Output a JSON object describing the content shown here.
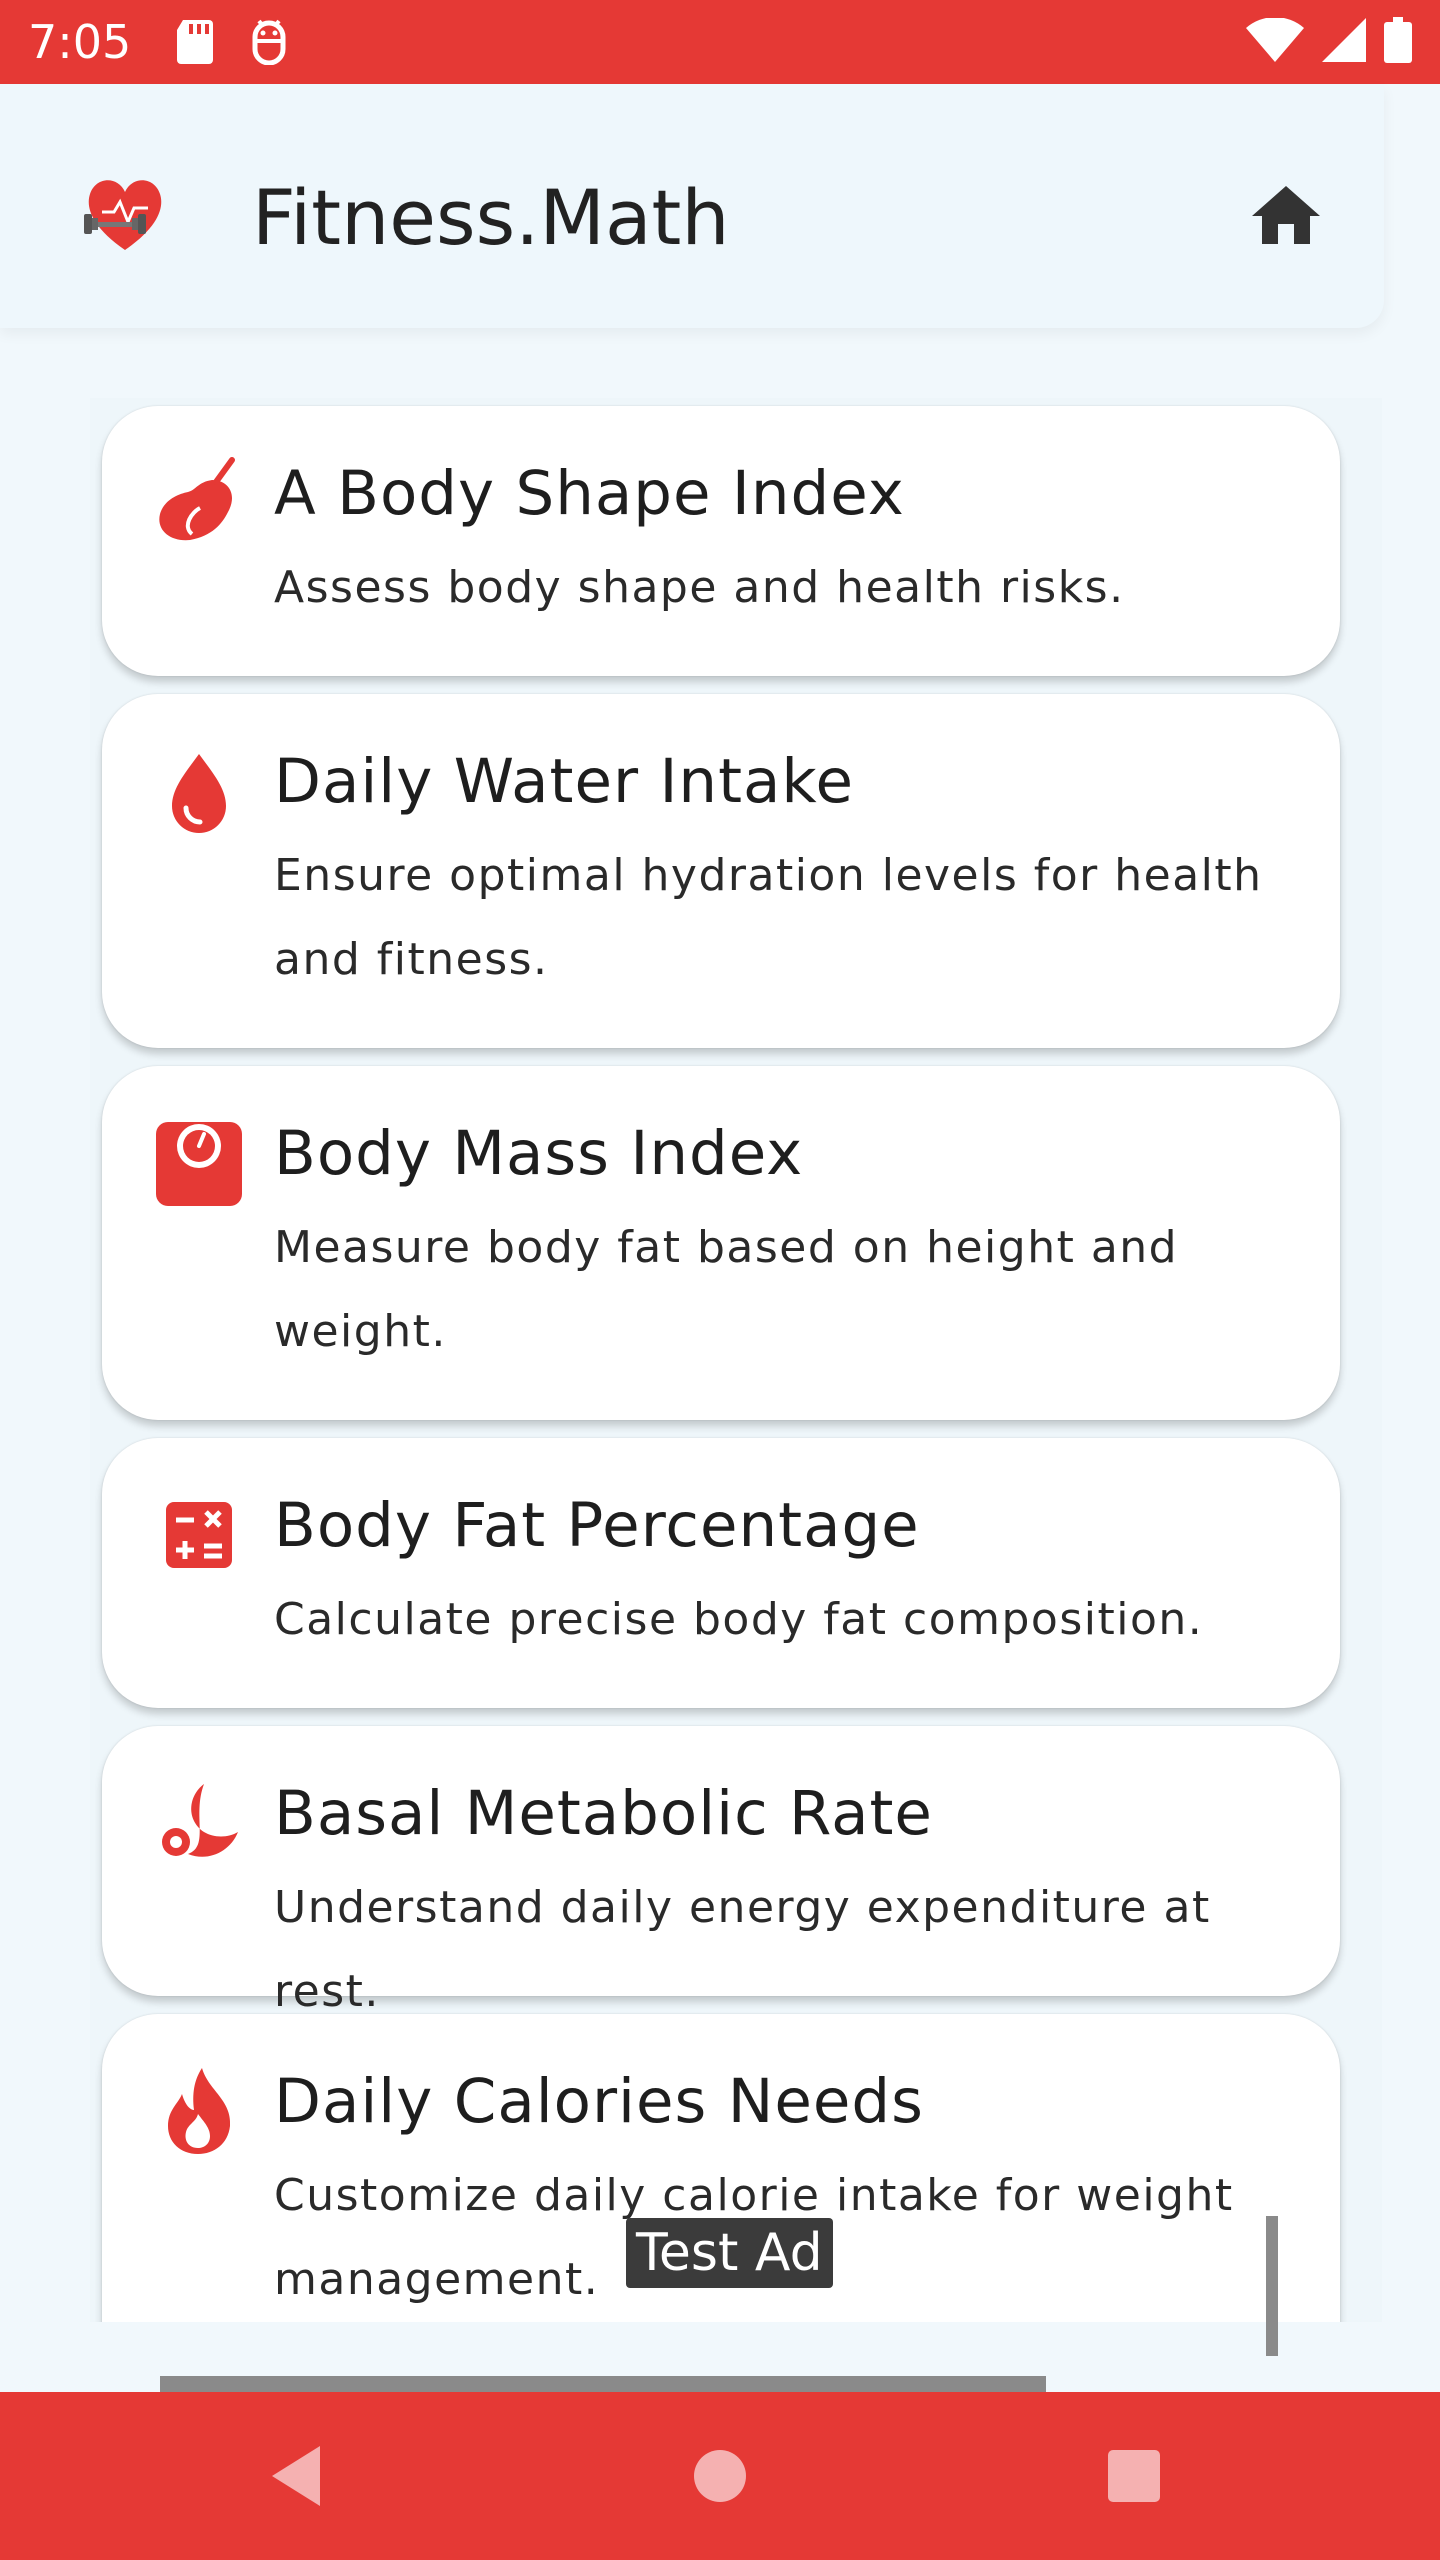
{
  "status_bar": {
    "time": "7:05",
    "icons_left": [
      "sd-card-icon",
      "android-debug-icon"
    ],
    "icons_right": [
      "wifi-icon",
      "cell-signal-icon",
      "battery-icon"
    ],
    "color": "#E53935"
  },
  "app_bar": {
    "title": "Fitness.Math",
    "logo": "heart-dumbbell-logo",
    "home_icon": "home-icon"
  },
  "cards": [
    {
      "title": "A Body Shape Index",
      "description": "Assess body shape and health risks.",
      "icon": "pear-icon"
    },
    {
      "title": "Daily Water Intake",
      "description": "Ensure optimal hydration levels for health and fitness.",
      "icon": "water-drop-icon"
    },
    {
      "title": "Body Mass Index",
      "description": "Measure body fat based on height and weight.",
      "icon": "scale-icon"
    },
    {
      "title": "Body Fat Percentage",
      "description": "Calculate precise body fat composition.",
      "icon": "calculator-icon"
    },
    {
      "title": "Basal Metabolic Rate",
      "description": "Understand daily energy expenditure at rest.",
      "icon": "moon-rest-icon"
    },
    {
      "title": "Daily Calories Needs",
      "description": "Customize daily calorie intake for weight management.",
      "icon": "flame-icon"
    }
  ],
  "ad": {
    "label": "Test Ad"
  },
  "nav_bar": {
    "buttons": [
      "back-icon",
      "home-circle-icon",
      "recents-icon"
    ],
    "color": "#E53935"
  },
  "theme": {
    "accent": "#E53935",
    "background": "#F1F8FC"
  }
}
